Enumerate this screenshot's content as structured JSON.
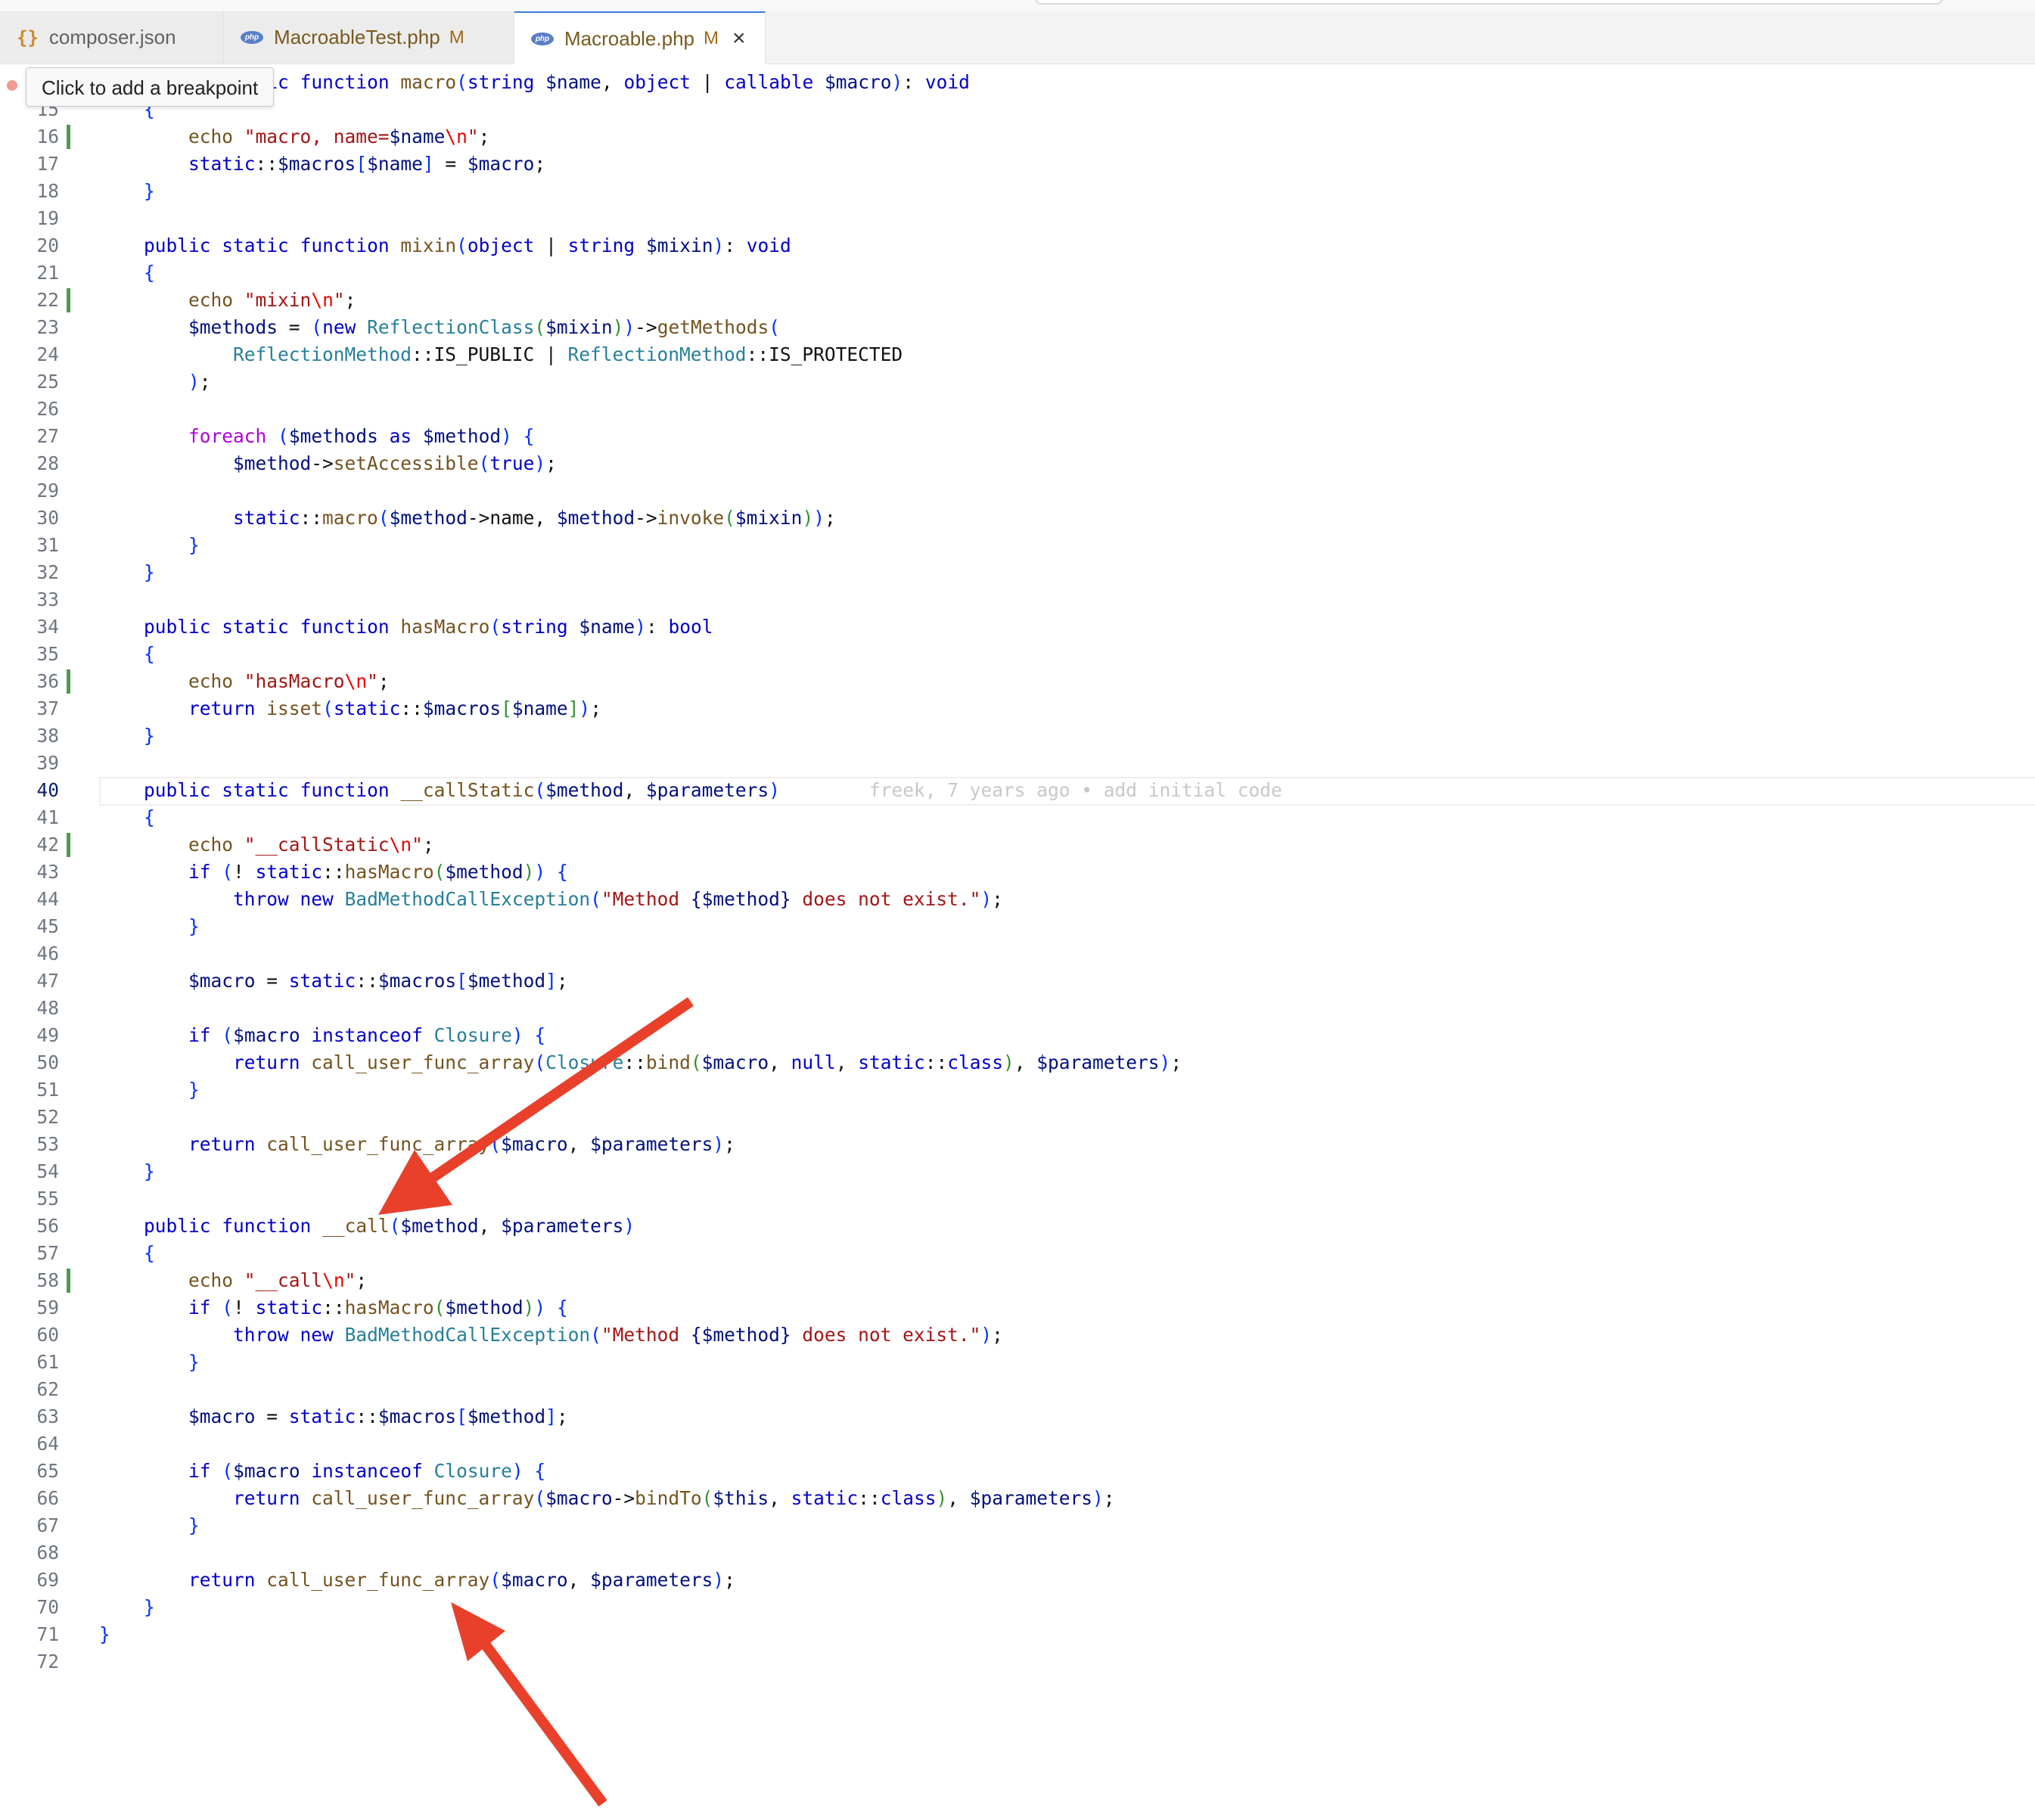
{
  "editor": {
    "tabs": [
      {
        "label": "composer.json",
        "icon": "json-braces-icon",
        "modified": "",
        "active": false
      },
      {
        "label": "MacroableTest.php",
        "icon": "php-icon",
        "modified": "M",
        "active": false
      },
      {
        "label": "Macroable.php",
        "icon": "php-icon",
        "modified": "M",
        "active": true
      }
    ],
    "tooltip": "Click to add a breakpoint",
    "blame": "freek, 7 years ago • add initial code",
    "current_line": "40",
    "colors": {
      "annotation_arrow": "#e8402b",
      "git_modified": "#4e9a4e",
      "accent": "#3b7dd8"
    }
  },
  "code_lines": [
    {
      "n": "",
      "code": "    public static function macro(string $name, object | callable $macro): void"
    },
    {
      "n": "15",
      "code": "    {"
    },
    {
      "n": "16",
      "code": "        echo \"macro, name=$name\\n\";"
    },
    {
      "n": "17",
      "code": "        static::$macros[$name] = $macro;"
    },
    {
      "n": "18",
      "code": "    }"
    },
    {
      "n": "19",
      "code": ""
    },
    {
      "n": "20",
      "code": "    public static function mixin(object | string $mixin): void"
    },
    {
      "n": "21",
      "code": "    {"
    },
    {
      "n": "22",
      "code": "        echo \"mixin\\n\";"
    },
    {
      "n": "23",
      "code": "        $methods = (new ReflectionClass($mixin))->getMethods("
    },
    {
      "n": "24",
      "code": "            ReflectionMethod::IS_PUBLIC | ReflectionMethod::IS_PROTECTED"
    },
    {
      "n": "25",
      "code": "        );"
    },
    {
      "n": "26",
      "code": ""
    },
    {
      "n": "27",
      "code": "        foreach ($methods as $method) {"
    },
    {
      "n": "28",
      "code": "            $method->setAccessible(true);"
    },
    {
      "n": "29",
      "code": ""
    },
    {
      "n": "30",
      "code": "            static::macro($method->name, $method->invoke($mixin));"
    },
    {
      "n": "31",
      "code": "        }"
    },
    {
      "n": "32",
      "code": "    }"
    },
    {
      "n": "33",
      "code": ""
    },
    {
      "n": "34",
      "code": "    public static function hasMacro(string $name): bool"
    },
    {
      "n": "35",
      "code": "    {"
    },
    {
      "n": "36",
      "code": "        echo \"hasMacro\\n\";"
    },
    {
      "n": "37",
      "code": "        return isset(static::$macros[$name]);"
    },
    {
      "n": "38",
      "code": "    }"
    },
    {
      "n": "39",
      "code": ""
    },
    {
      "n": "40",
      "code": "    public static function __callStatic($method, $parameters)"
    },
    {
      "n": "41",
      "code": "    {"
    },
    {
      "n": "42",
      "code": "        echo \"__callStatic\\n\";"
    },
    {
      "n": "43",
      "code": "        if (! static::hasMacro($method)) {"
    },
    {
      "n": "44",
      "code": "            throw new BadMethodCallException(\"Method {$method} does not exist.\");"
    },
    {
      "n": "45",
      "code": "        }"
    },
    {
      "n": "46",
      "code": ""
    },
    {
      "n": "47",
      "code": "        $macro = static::$macros[$method];"
    },
    {
      "n": "48",
      "code": ""
    },
    {
      "n": "49",
      "code": "        if ($macro instanceof Closure) {"
    },
    {
      "n": "50",
      "code": "            return call_user_func_array(Closure::bind($macro, null, static::class), $parameters);"
    },
    {
      "n": "51",
      "code": "        }"
    },
    {
      "n": "52",
      "code": ""
    },
    {
      "n": "53",
      "code": "        return call_user_func_array($macro, $parameters);"
    },
    {
      "n": "54",
      "code": "    }"
    },
    {
      "n": "55",
      "code": ""
    },
    {
      "n": "56",
      "code": "    public function __call($method, $parameters)"
    },
    {
      "n": "57",
      "code": "    {"
    },
    {
      "n": "58",
      "code": "        echo \"__call\\n\";"
    },
    {
      "n": "59",
      "code": "        if (! static::hasMacro($method)) {"
    },
    {
      "n": "60",
      "code": "            throw new BadMethodCallException(\"Method {$method} does not exist.\");"
    },
    {
      "n": "61",
      "code": "        }"
    },
    {
      "n": "62",
      "code": ""
    },
    {
      "n": "63",
      "code": "        $macro = static::$macros[$method];"
    },
    {
      "n": "64",
      "code": ""
    },
    {
      "n": "65",
      "code": "        if ($macro instanceof Closure) {"
    },
    {
      "n": "66",
      "code": "            return call_user_func_array($macro->bindTo($this, static::class), $parameters);"
    },
    {
      "n": "67",
      "code": "        }"
    },
    {
      "n": "68",
      "code": ""
    },
    {
      "n": "69",
      "code": "        return call_user_func_array($macro, $parameters);"
    },
    {
      "n": "70",
      "code": "    }"
    },
    {
      "n": "71",
      "code": "}"
    },
    {
      "n": "72",
      "code": ""
    }
  ]
}
